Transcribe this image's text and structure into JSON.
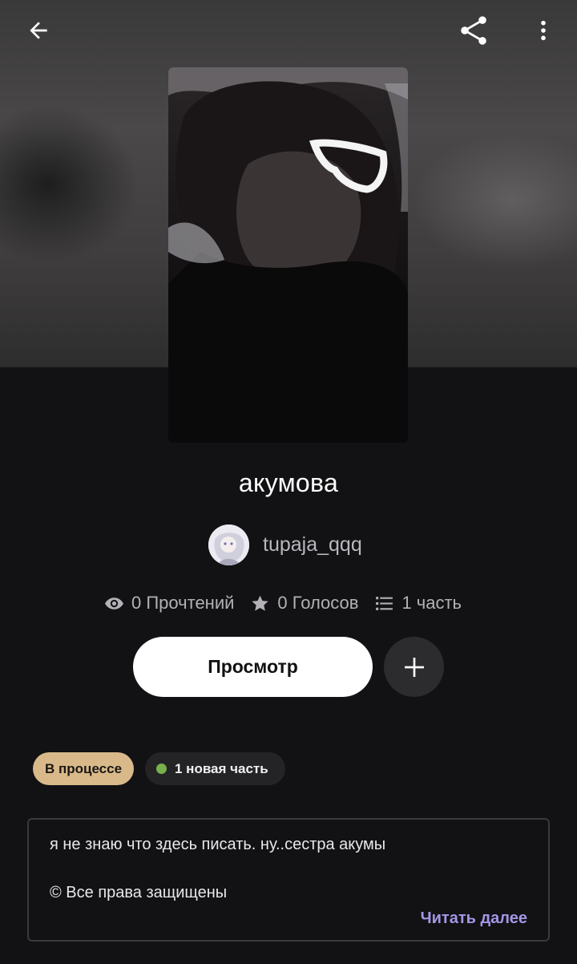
{
  "header": {
    "back_icon": "arrow-left-icon",
    "share_icon": "share-icon",
    "more_icon": "more-vertical-icon"
  },
  "book": {
    "title": "акумова",
    "author": "tupaja_qqq"
  },
  "stats": {
    "reads": "0 Прочтений",
    "votes": "0 Голосов",
    "parts": "1 часть"
  },
  "actions": {
    "view_label": "Просмотр",
    "add_icon": "plus-icon"
  },
  "tags": {
    "status": "В процессе",
    "new_part": "1 новая часть"
  },
  "description": {
    "text": "я не знаю что здесь писать. ну..сестра акумы",
    "copyright": "© Все права защищены",
    "read_more": "Читать далее"
  },
  "colors": {
    "background": "#121113",
    "status_badge": "#d9b98a",
    "new_dot": "#78b04a",
    "read_more": "#a397e6"
  }
}
